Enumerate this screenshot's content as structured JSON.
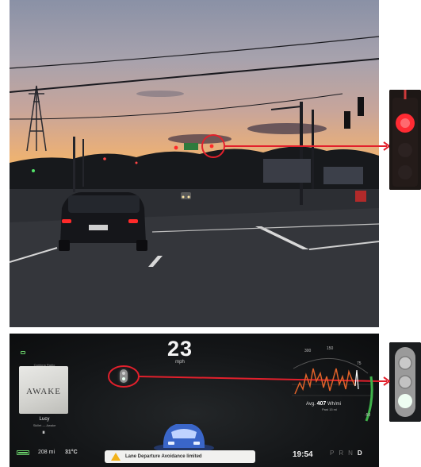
{
  "dashboard": {
    "speed": "23",
    "speed_unit": "mph",
    "media": {
      "source": "Cantona Radio",
      "album_title": "AWAKE",
      "song": "Lucy",
      "artist": "Skillet — Awake",
      "pause_glyph": "⏸"
    },
    "status": {
      "range": "208 mi",
      "temperature": "31°C",
      "time": "19:54"
    },
    "alert": {
      "text": "Lane Departure Avoidance limited",
      "icon": "warning-triangle-icon"
    },
    "gears": [
      "P",
      "R",
      "N",
      "D"
    ],
    "active_gear": "D",
    "energy": {
      "scale_max": "300",
      "scale_mid": "150",
      "scale_75": "75",
      "scale_min": "-50",
      "avg_label": "Avg.",
      "avg_value": "407",
      "avg_unit": "Wh/mi",
      "past_label": "Past 15 mi"
    }
  },
  "colors": {
    "callout": "#e2202c",
    "battery": "#6bd26b",
    "alert_icon": "#f2b21a",
    "energy_graph": "#e0622a",
    "regen_arc": "#3fb34a"
  }
}
